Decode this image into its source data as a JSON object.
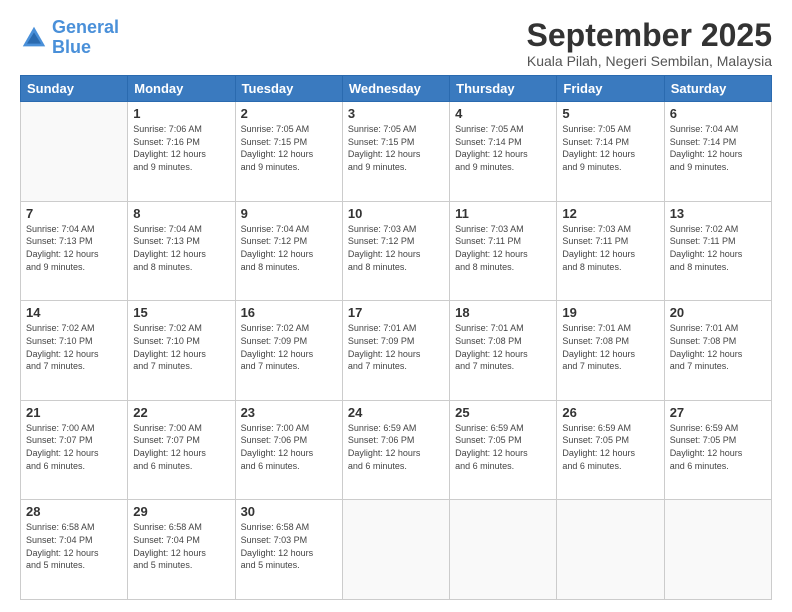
{
  "logo": {
    "name_part1": "General",
    "name_part2": "Blue"
  },
  "title": "September 2025",
  "subtitle": "Kuala Pilah, Negeri Sembilan, Malaysia",
  "days": [
    "Sunday",
    "Monday",
    "Tuesday",
    "Wednesday",
    "Thursday",
    "Friday",
    "Saturday"
  ],
  "weeks": [
    [
      {
        "day": "",
        "info": ""
      },
      {
        "day": "1",
        "info": "Sunrise: 7:06 AM\nSunset: 7:16 PM\nDaylight: 12 hours\nand 9 minutes."
      },
      {
        "day": "2",
        "info": "Sunrise: 7:05 AM\nSunset: 7:15 PM\nDaylight: 12 hours\nand 9 minutes."
      },
      {
        "day": "3",
        "info": "Sunrise: 7:05 AM\nSunset: 7:15 PM\nDaylight: 12 hours\nand 9 minutes."
      },
      {
        "day": "4",
        "info": "Sunrise: 7:05 AM\nSunset: 7:14 PM\nDaylight: 12 hours\nand 9 minutes."
      },
      {
        "day": "5",
        "info": "Sunrise: 7:05 AM\nSunset: 7:14 PM\nDaylight: 12 hours\nand 9 minutes."
      },
      {
        "day": "6",
        "info": "Sunrise: 7:04 AM\nSunset: 7:14 PM\nDaylight: 12 hours\nand 9 minutes."
      }
    ],
    [
      {
        "day": "7",
        "info": "Sunrise: 7:04 AM\nSunset: 7:13 PM\nDaylight: 12 hours\nand 9 minutes."
      },
      {
        "day": "8",
        "info": "Sunrise: 7:04 AM\nSunset: 7:13 PM\nDaylight: 12 hours\nand 8 minutes."
      },
      {
        "day": "9",
        "info": "Sunrise: 7:04 AM\nSunset: 7:12 PM\nDaylight: 12 hours\nand 8 minutes."
      },
      {
        "day": "10",
        "info": "Sunrise: 7:03 AM\nSunset: 7:12 PM\nDaylight: 12 hours\nand 8 minutes."
      },
      {
        "day": "11",
        "info": "Sunrise: 7:03 AM\nSunset: 7:11 PM\nDaylight: 12 hours\nand 8 minutes."
      },
      {
        "day": "12",
        "info": "Sunrise: 7:03 AM\nSunset: 7:11 PM\nDaylight: 12 hours\nand 8 minutes."
      },
      {
        "day": "13",
        "info": "Sunrise: 7:02 AM\nSunset: 7:11 PM\nDaylight: 12 hours\nand 8 minutes."
      }
    ],
    [
      {
        "day": "14",
        "info": "Sunrise: 7:02 AM\nSunset: 7:10 PM\nDaylight: 12 hours\nand 7 minutes."
      },
      {
        "day": "15",
        "info": "Sunrise: 7:02 AM\nSunset: 7:10 PM\nDaylight: 12 hours\nand 7 minutes."
      },
      {
        "day": "16",
        "info": "Sunrise: 7:02 AM\nSunset: 7:09 PM\nDaylight: 12 hours\nand 7 minutes."
      },
      {
        "day": "17",
        "info": "Sunrise: 7:01 AM\nSunset: 7:09 PM\nDaylight: 12 hours\nand 7 minutes."
      },
      {
        "day": "18",
        "info": "Sunrise: 7:01 AM\nSunset: 7:08 PM\nDaylight: 12 hours\nand 7 minutes."
      },
      {
        "day": "19",
        "info": "Sunrise: 7:01 AM\nSunset: 7:08 PM\nDaylight: 12 hours\nand 7 minutes."
      },
      {
        "day": "20",
        "info": "Sunrise: 7:01 AM\nSunset: 7:08 PM\nDaylight: 12 hours\nand 7 minutes."
      }
    ],
    [
      {
        "day": "21",
        "info": "Sunrise: 7:00 AM\nSunset: 7:07 PM\nDaylight: 12 hours\nand 6 minutes."
      },
      {
        "day": "22",
        "info": "Sunrise: 7:00 AM\nSunset: 7:07 PM\nDaylight: 12 hours\nand 6 minutes."
      },
      {
        "day": "23",
        "info": "Sunrise: 7:00 AM\nSunset: 7:06 PM\nDaylight: 12 hours\nand 6 minutes."
      },
      {
        "day": "24",
        "info": "Sunrise: 6:59 AM\nSunset: 7:06 PM\nDaylight: 12 hours\nand 6 minutes."
      },
      {
        "day": "25",
        "info": "Sunrise: 6:59 AM\nSunset: 7:05 PM\nDaylight: 12 hours\nand 6 minutes."
      },
      {
        "day": "26",
        "info": "Sunrise: 6:59 AM\nSunset: 7:05 PM\nDaylight: 12 hours\nand 6 minutes."
      },
      {
        "day": "27",
        "info": "Sunrise: 6:59 AM\nSunset: 7:05 PM\nDaylight: 12 hours\nand 6 minutes."
      }
    ],
    [
      {
        "day": "28",
        "info": "Sunrise: 6:58 AM\nSunset: 7:04 PM\nDaylight: 12 hours\nand 5 minutes."
      },
      {
        "day": "29",
        "info": "Sunrise: 6:58 AM\nSunset: 7:04 PM\nDaylight: 12 hours\nand 5 minutes."
      },
      {
        "day": "30",
        "info": "Sunrise: 6:58 AM\nSunset: 7:03 PM\nDaylight: 12 hours\nand 5 minutes."
      },
      {
        "day": "",
        "info": ""
      },
      {
        "day": "",
        "info": ""
      },
      {
        "day": "",
        "info": ""
      },
      {
        "day": "",
        "info": ""
      }
    ]
  ]
}
